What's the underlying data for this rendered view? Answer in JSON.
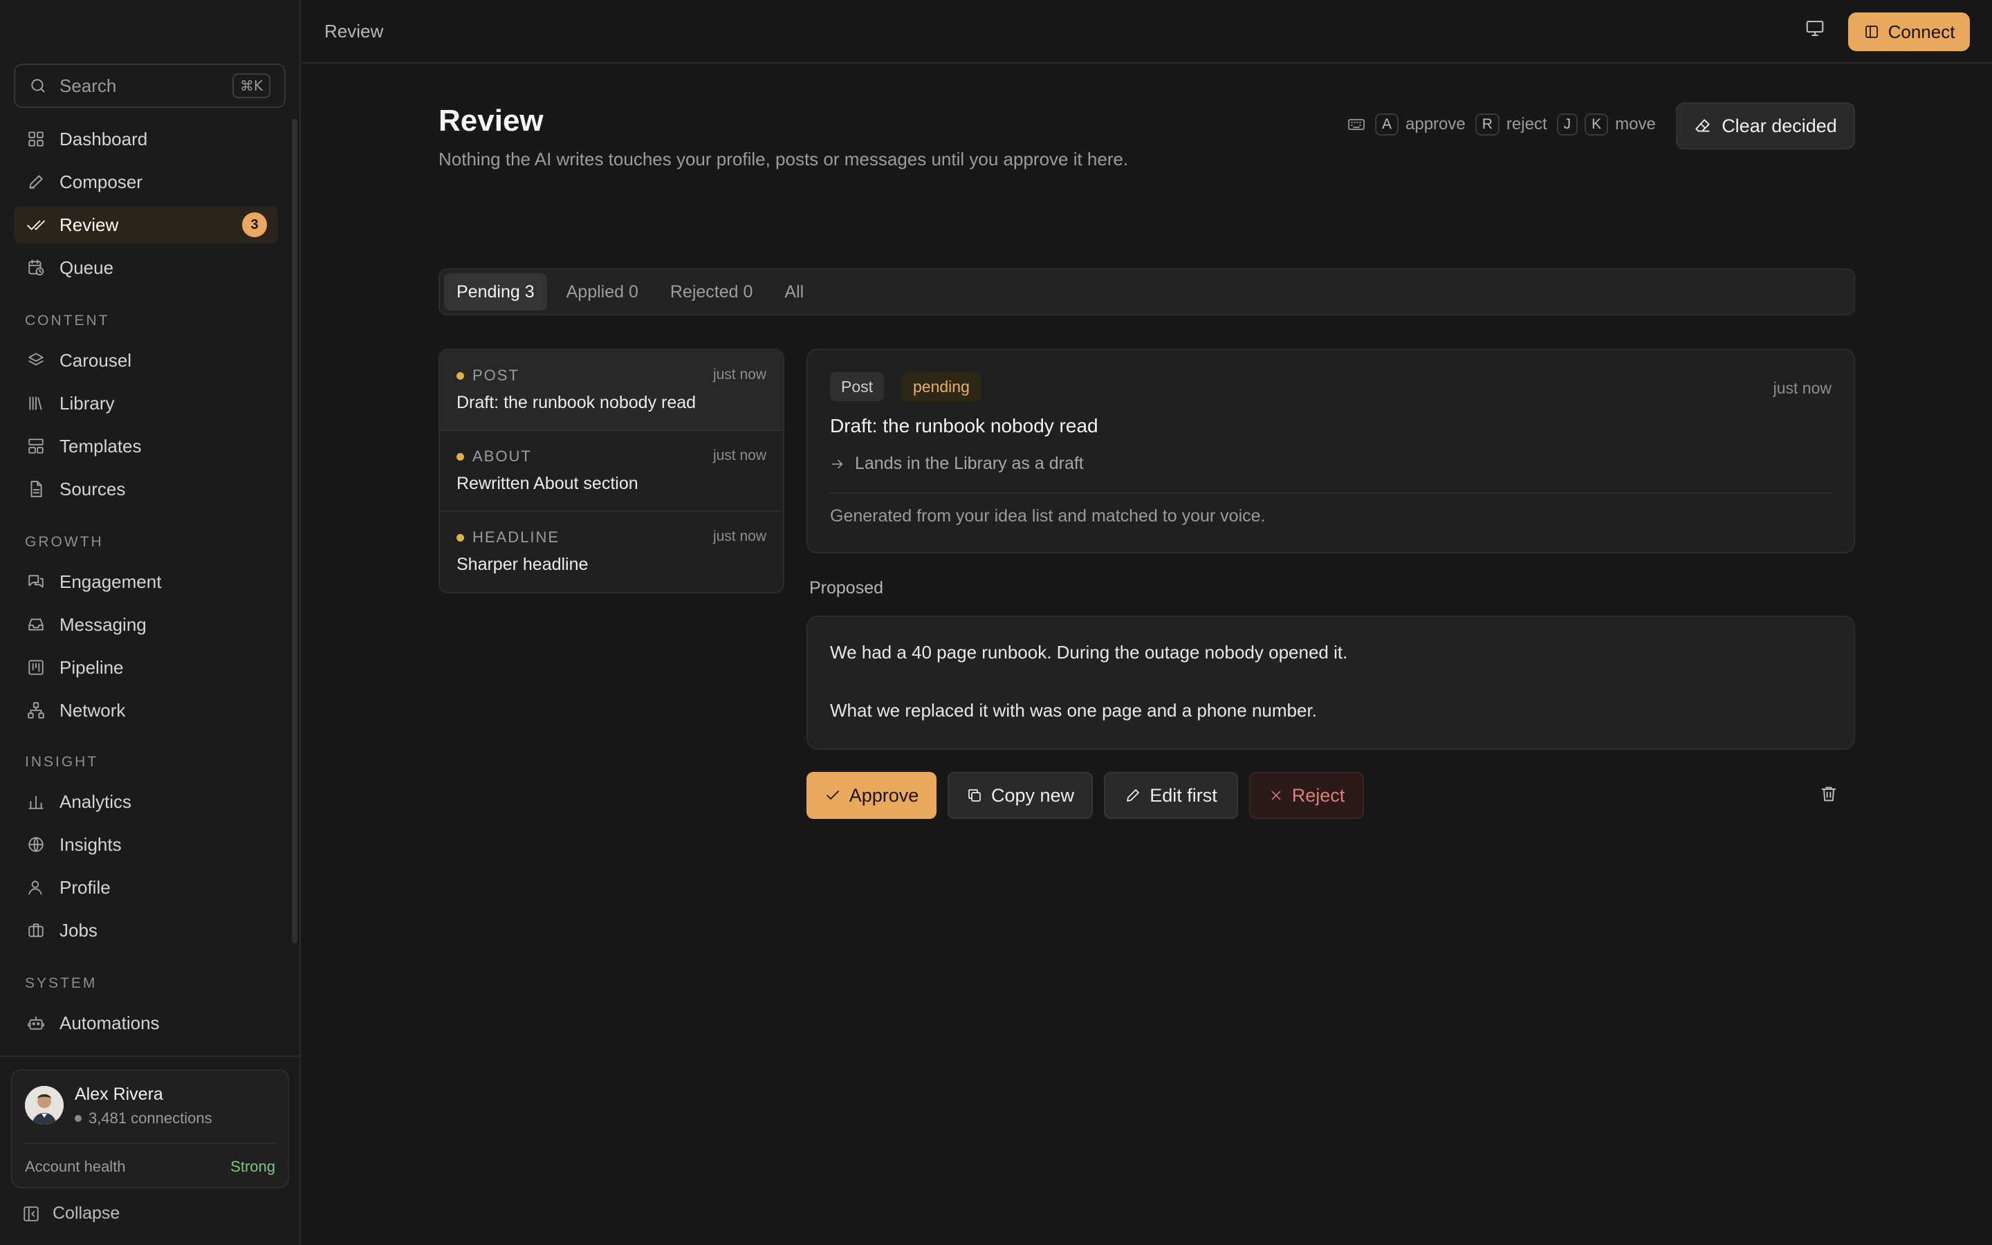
{
  "sidebar": {
    "search_placeholder": "Search",
    "search_shortcut": "⌘K",
    "items": [
      {
        "label": "Dashboard",
        "icon": "grid-icon"
      },
      {
        "label": "Composer",
        "icon": "pencil-icon"
      },
      {
        "label": "Review",
        "icon": "double-check-icon",
        "badge": "3",
        "active": true
      },
      {
        "label": "Queue",
        "icon": "calendar-clock-icon"
      }
    ],
    "sections": {
      "content": {
        "title": "CONTENT",
        "items": [
          "Carousel",
          "Library",
          "Templates",
          "Sources"
        ]
      },
      "growth": {
        "title": "GROWTH",
        "items": [
          "Engagement",
          "Messaging",
          "Pipeline",
          "Network"
        ]
      },
      "insight": {
        "title": "INSIGHT",
        "items": [
          "Analytics",
          "Insights",
          "Profile",
          "Jobs"
        ]
      },
      "system": {
        "title": "SYSTEM",
        "items": [
          "Automations"
        ]
      }
    },
    "user": {
      "name": "Alex Rivera",
      "connections": "3,481 connections"
    },
    "health": {
      "label": "Account health",
      "value": "Strong",
      "color": "#7fc77f"
    },
    "collapse_label": "Collapse"
  },
  "topbar": {
    "breadcrumb": "Review",
    "connect_label": "Connect",
    "accent": "#e9a85c"
  },
  "header": {
    "title": "Review",
    "subtitle": "Nothing the AI writes touches your profile, posts or messages until you approve it here.",
    "shortcuts": {
      "k1": "A",
      "l1": "approve",
      "k2": "R",
      "l2": "reject",
      "k3": "J",
      "k4": "K",
      "l3": "move"
    },
    "clear_label": "Clear decided"
  },
  "tabs": [
    {
      "label": "Pending 3",
      "active": true
    },
    {
      "label": "Applied 0"
    },
    {
      "label": "Rejected 0"
    },
    {
      "label": "All"
    }
  ],
  "list": [
    {
      "kind": "POST",
      "time": "just now",
      "title": "Draft: the runbook nobody read"
    },
    {
      "kind": "ABOUT",
      "time": "just now",
      "title": "Rewritten About section"
    },
    {
      "kind": "HEADLINE",
      "time": "just now",
      "title": "Sharper headline"
    }
  ],
  "detail": {
    "type": "Post",
    "status": "pending",
    "time": "just now",
    "title": "Draft: the runbook nobody read",
    "destination": "Lands in the Library as a draft",
    "note": "Generated from your idea list and matched to your voice."
  },
  "proposed": {
    "label": "Proposed",
    "line1": "We had a 40 page runbook. During the outage nobody opened it.",
    "line2": "What we replaced it with was one page and a phone number."
  },
  "actions": {
    "approve": "Approve",
    "copy": "Copy new",
    "edit": "Edit first",
    "reject": "Reject"
  }
}
